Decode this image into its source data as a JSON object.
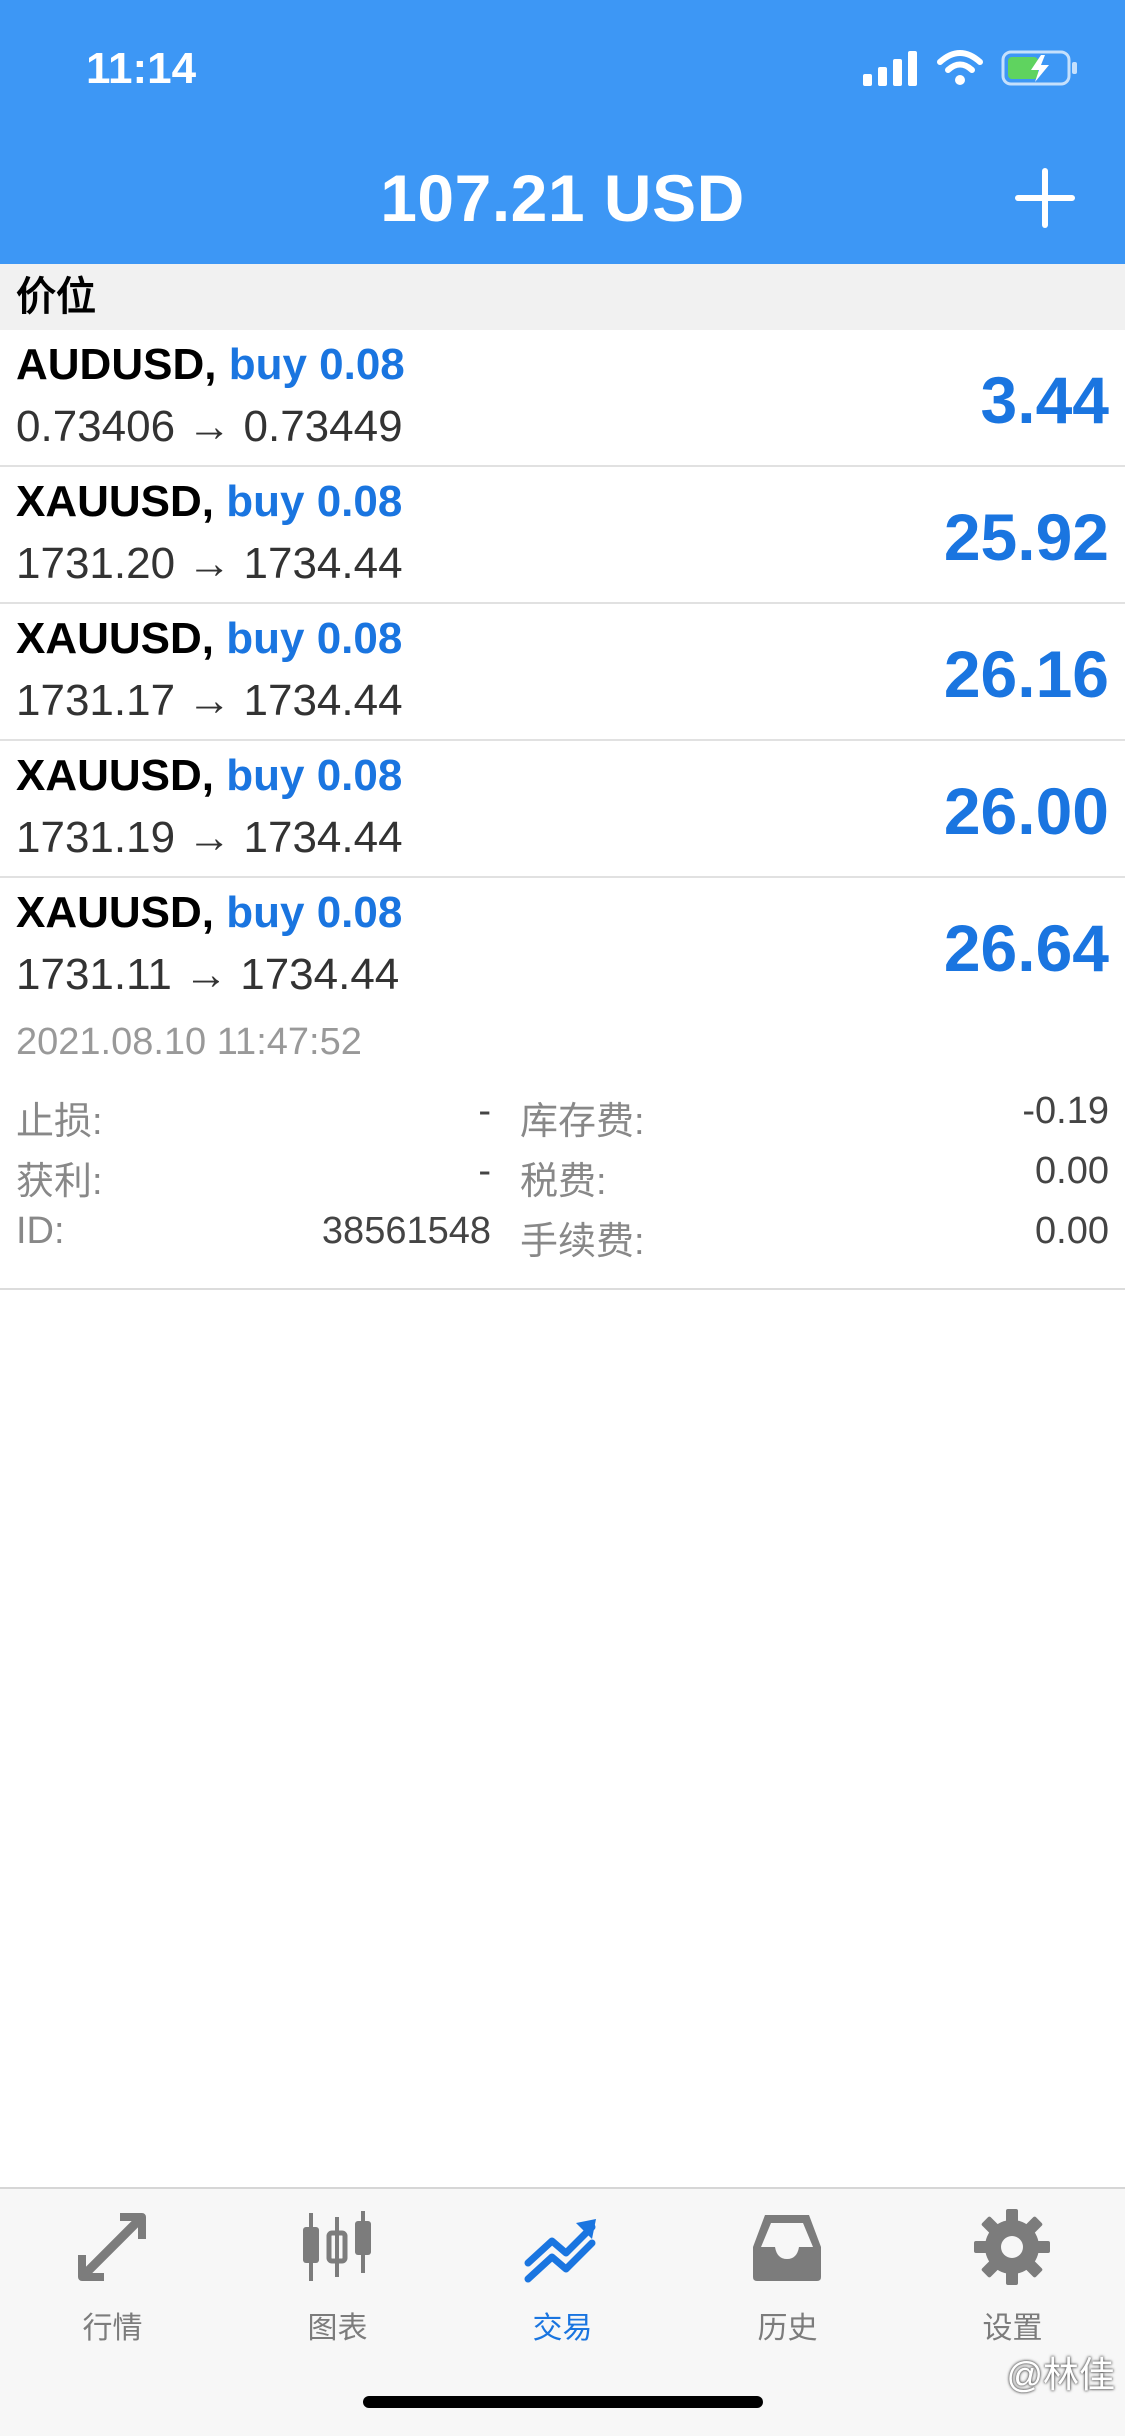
{
  "status_bar": {
    "time": "11:14"
  },
  "header": {
    "title": "107.21 USD"
  },
  "section": {
    "title": "价位"
  },
  "positions": [
    {
      "symbol": "AUDUSD,",
      "direction": "buy 0.08",
      "prices": "0.73406 → 0.73449",
      "profit": "3.44"
    },
    {
      "symbol": "XAUUSD,",
      "direction": "buy 0.08",
      "prices": "1731.20 → 1734.44",
      "profit": "25.92"
    },
    {
      "symbol": "XAUUSD,",
      "direction": "buy 0.08",
      "prices": "1731.17 → 1734.44",
      "profit": "26.16"
    },
    {
      "symbol": "XAUUSD,",
      "direction": "buy 0.08",
      "prices": "1731.19 → 1734.44",
      "profit": "26.00"
    },
    {
      "symbol": "XAUUSD,",
      "direction": "buy 0.08",
      "prices": "1731.11 → 1734.44",
      "profit": "26.64"
    }
  ],
  "detail": {
    "time": "2021.08.10 11:47:52",
    "rows": [
      {
        "left_label": "止损:",
        "left_value": "-",
        "right_label": "库存费:",
        "right_value": "-0.19"
      },
      {
        "left_label": "获利:",
        "left_value": "-",
        "right_label": "税费:",
        "right_value": "0.00"
      },
      {
        "left_label": "ID:",
        "left_value": "38561548",
        "right_label": "手续费:",
        "right_value": "0.00"
      }
    ]
  },
  "tabs": [
    {
      "label": "行情",
      "icon": "arrows-icon",
      "active": false
    },
    {
      "label": "图表",
      "icon": "candlestick-icon",
      "active": false
    },
    {
      "label": "交易",
      "icon": "trend-chart-icon",
      "active": true
    },
    {
      "label": "历史",
      "icon": "inbox-icon",
      "active": false
    },
    {
      "label": "设置",
      "icon": "gear-icon",
      "active": false
    }
  ],
  "watermark": "@林佳",
  "colors": {
    "header_bg": "#3d97f5",
    "accent": "#1a75e0",
    "tab_inactive": "#7c7c7c"
  }
}
